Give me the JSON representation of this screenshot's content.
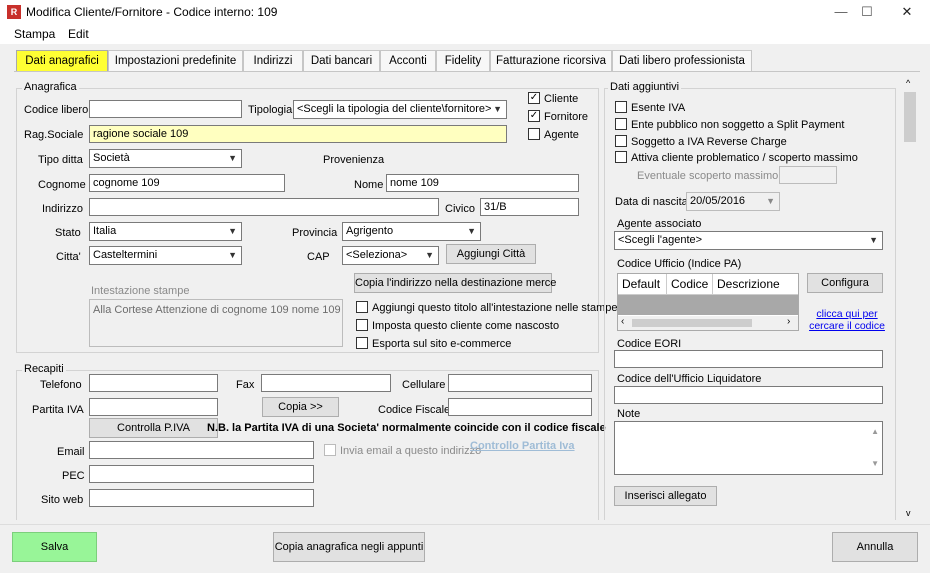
{
  "window": {
    "title": "Modifica Cliente/Fornitore - Codice interno: 109",
    "app_icon_letter": "R",
    "minimize": "—",
    "maximize": "☐",
    "close": "✕"
  },
  "menu": {
    "stampa": "Stampa",
    "edit": "Edit"
  },
  "tabs": [
    "Dati anagrafici",
    "Impostazioni predefinite",
    "Indirizzi",
    "Dati bancari",
    "Acconti",
    "Fidelity",
    "Fatturazione ricorsiva",
    "Dati libero professionista"
  ],
  "anagrafica": {
    "group_title": "Anagrafica",
    "codice_libero_label": "Codice libero",
    "codice_libero_value": "",
    "tipologia_label": "Tipologia",
    "tipologia_value": "<Scegli la tipologia del cliente\\fornitore>",
    "cliente_label": "Cliente",
    "fornitore_label": "Fornitore",
    "agente_label": "Agente",
    "rag_sociale_label": "Rag.Sociale",
    "rag_sociale_value": "ragione sociale 109",
    "tipo_ditta_label": "Tipo ditta",
    "tipo_ditta_value": "Società",
    "provenienza_label": "Provenienza",
    "cognome_label": "Cognome",
    "cognome_value": "cognome 109",
    "nome_label": "Nome",
    "nome_value": "nome 109",
    "indirizzo_label": "Indirizzo",
    "indirizzo_value": "",
    "civico_label": "Civico",
    "civico_value": "31/B",
    "stato_label": "Stato",
    "stato_value": "Italia",
    "provincia_label": "Provincia",
    "provincia_value": "Agrigento",
    "citta_label": "Citta'",
    "citta_value": "Casteltermini",
    "cap_label": "CAP",
    "cap_value": "<Seleziona>",
    "aggiungi_citta": "Aggiungi Città",
    "copia_indirizzo": "Copia l'indirizzo nella destinazione merce",
    "intestazione_label": "Intestazione stampe",
    "intestazione_value": "Alla Cortese Attenzione di cognome 109 nome 109",
    "opt_titolo": "Aggiungi questo titolo all'intestazione nelle stampe",
    "opt_nascosto": "Imposta questo cliente come nascosto",
    "opt_ecommerce": "Esporta sul sito e-commerce"
  },
  "recapiti": {
    "group_title": "Recapiti",
    "telefono_label": "Telefono",
    "fax_label": "Fax",
    "cellulare_label": "Cellulare",
    "partita_iva_label": "Partita IVA",
    "copia_btn": "Copia >>",
    "codice_fiscale_label": "Codice Fiscale",
    "controlla_piva": "Controlla P.IVA",
    "nb_text": "N.B. la Partita IVA di una Societa' normalmente coincide con il codice fiscale",
    "email_label": "Email",
    "invia_email": "Invia email a questo indirizzo",
    "controllo_piva_link": "Controllo Partita Iva",
    "pec_label": "PEC",
    "sito_label": "Sito web"
  },
  "aggiuntivi": {
    "group_title": "Dati aggiuntivi",
    "esente_iva": "Esente IVA",
    "split_payment": "Ente pubblico non soggetto a Split Payment",
    "reverse_charge": "Soggetto a IVA Reverse Charge",
    "problematico": "Attiva cliente problematico / scoperto massimo",
    "scoperto_label": "Eventuale scoperto massimo",
    "data_nascita_label": "Data di nascita",
    "data_nascita_value": "20/05/2016",
    "agente_label": "Agente associato",
    "agente_value": "<Scegli l'agente>",
    "codice_ufficio_label": "Codice Ufficio (Indice PA)",
    "grid_columns": [
      "Default",
      "Codice",
      "Descrizione"
    ],
    "configura": "Configura",
    "link_line1": "clicca qui per",
    "link_line2": "cercare il codice",
    "eori_label": "Codice EORI",
    "liquidatore_label": "Codice dell'Ufficio Liquidatore",
    "note_label": "Note",
    "inserisci_allegato": "Inserisci allegato"
  },
  "footer": {
    "salva": "Salva",
    "copia_appunti": "Copia anagrafica negli appunti",
    "annulla": "Annulla"
  },
  "colors": {
    "active_tab": "#ffff33",
    "salva_bg": "#98f598",
    "rag_sociale_bg": "#ffffc0",
    "link": "#0000ee"
  }
}
